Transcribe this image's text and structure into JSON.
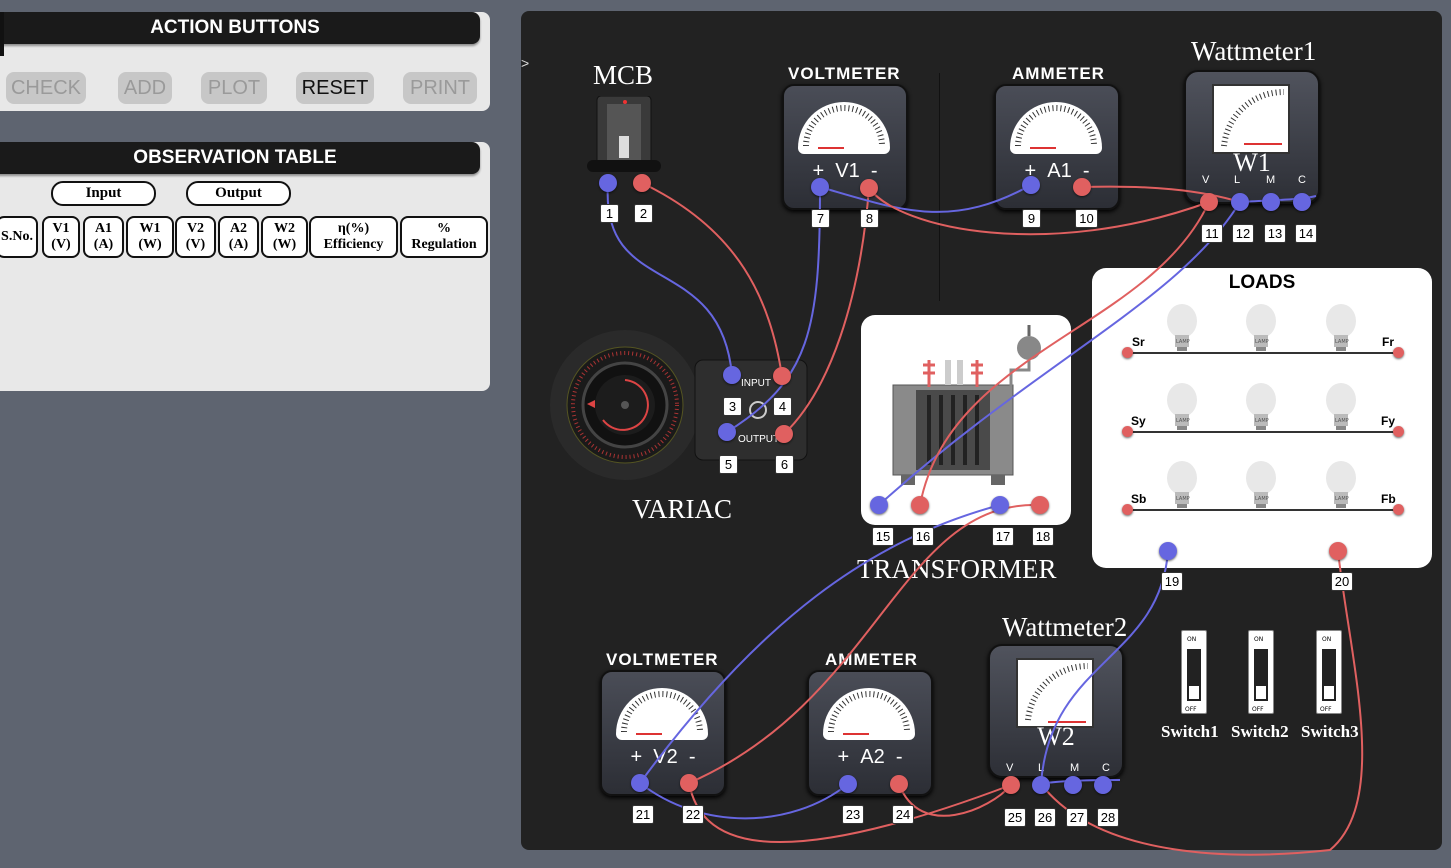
{
  "action_panel": {
    "title": "ACTION BUTTONS",
    "buttons": {
      "check": "CHECK",
      "add": "ADD",
      "plot": "PLOT",
      "reset": "RESET",
      "print": "PRINT"
    }
  },
  "observation_panel": {
    "title": "OBSERVATION TABLE",
    "input_label": "Input",
    "output_label": "Output",
    "columns": {
      "sno": "S.No.",
      "v1": "V1\n(V)",
      "a1": "A1\n(A)",
      "w1": "W1\n(W)",
      "v2": "V2\n(V)",
      "a2": "A2\n(A)",
      "w2": "W2\n(W)",
      "eff": "η(%)\nEfficiency",
      "reg": "%\nRegulation"
    }
  },
  "board": {
    "stray_mark": ">",
    "mcb": {
      "label": "MCB"
    },
    "variac": {
      "label": "VARIAC",
      "input_text": "INPUT",
      "output_text": "OUTPUT"
    },
    "transformer": {
      "label": "TRANSFORMER"
    },
    "voltmeter1": {
      "title": "VOLTMETER",
      "plus": "+",
      "name": "V1",
      "minus": "-"
    },
    "ammeter1": {
      "title": "AMMETER",
      "plus": "+",
      "name": "A1",
      "minus": "-"
    },
    "wattmeter1": {
      "title": "Wattmeter1",
      "name": "W1",
      "terms": [
        "V",
        "L",
        "M",
        "C"
      ]
    },
    "voltmeter2": {
      "title": "VOLTMETER",
      "plus": "+",
      "name": "V2",
      "minus": "-"
    },
    "ammeter2": {
      "title": "AMMETER",
      "plus": "+",
      "name": "A2",
      "minus": "-"
    },
    "wattmeter2": {
      "title": "Wattmeter2",
      "name": "W2",
      "terms": [
        "V",
        "L",
        "M",
        "C"
      ]
    },
    "loads": {
      "title": "LOADS",
      "rows": [
        {
          "left": "Sr",
          "right": "Fr"
        },
        {
          "left": "Sy",
          "right": "Fy"
        },
        {
          "left": "Sb",
          "right": "Fb"
        }
      ],
      "lamp_text": "LAMP"
    },
    "switches": [
      {
        "label": "Switch1",
        "on": "ON",
        "off": "OFF"
      },
      {
        "label": "Switch2",
        "on": "ON",
        "off": "OFF"
      },
      {
        "label": "Switch3",
        "on": "ON",
        "off": "OFF"
      }
    ],
    "terminal_numbers": [
      "1",
      "2",
      "3",
      "4",
      "5",
      "6",
      "7",
      "8",
      "9",
      "10",
      "11",
      "12",
      "13",
      "14",
      "15",
      "16",
      "17",
      "18",
      "19",
      "20",
      "21",
      "22",
      "23",
      "24",
      "25",
      "26",
      "27",
      "28"
    ],
    "colors": {
      "blue_wire": "#6666e0",
      "red_wire": "#e06060",
      "board": "#222222"
    }
  }
}
